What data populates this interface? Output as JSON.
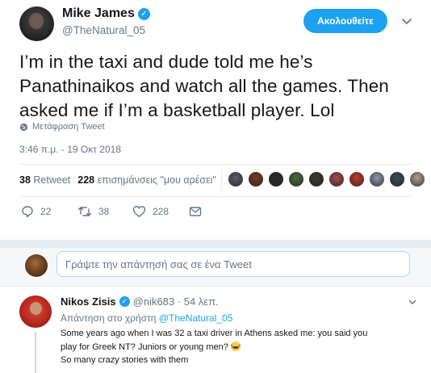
{
  "tweet": {
    "author_name": "Mike James",
    "author_handle": "@TheNatural_05",
    "follow_label": "Ακολουθείτε",
    "text": "I’m in the taxi and dude told me he’s Panathinaikos and watch all the games. Then asked me if I’m a basketball player. Lol",
    "translate_label": "Μετάφραση Tweet",
    "timestamp": "3:46 π.μ. - 19 Οκτ 2018",
    "stats": {
      "retweets_count": "38",
      "retweets_label": "Retweet",
      "likes_count": "228",
      "likes_label": "επισημάνσεις \"μου αρέσει\""
    },
    "likers": [
      {
        "icon": "liker-avatar-1",
        "color": "#5b5b6b"
      },
      {
        "icon": "liker-avatar-2",
        "color": "#7a3b1e"
      },
      {
        "icon": "liker-avatar-3",
        "color": "#2b2b2b"
      },
      {
        "icon": "liker-avatar-4",
        "color": "#4b6b3b"
      },
      {
        "icon": "liker-avatar-5",
        "color": "#3b3b2b"
      },
      {
        "icon": "liker-avatar-6",
        "color": "#a84a4a"
      },
      {
        "icon": "liker-avatar-7",
        "color": "#c0392b"
      },
      {
        "icon": "liker-avatar-8",
        "color": "#8a9aa8"
      },
      {
        "icon": "liker-avatar-9",
        "color": "#3b4b5b"
      },
      {
        "icon": "liker-avatar-10",
        "color": "#b0a090"
      }
    ],
    "actions": {
      "reply_count": "22",
      "retweet_count": "38",
      "like_count": "228"
    }
  },
  "reply_box": {
    "placeholder": "Γράψτε την απάντησή σας σε ένα Tweet"
  },
  "reply": {
    "author_name": "Nikos Zisis",
    "author_handle": "@nik683",
    "time": "54 λεπ.",
    "reply_to_label": "Απάντηση στο χρήστη",
    "reply_to_handle": "@TheNatural_05",
    "text_line1": "Some years ago when I was 32 a taxi driver in Athens asked me: you said you",
    "text_line2": "play for Greek NT? Juniors or young men?",
    "text_line3": "So many crazy stories with them"
  },
  "colors": {
    "accent": "#1da1f2",
    "secondary_text": "#657786",
    "divider": "#e6ecf0"
  }
}
